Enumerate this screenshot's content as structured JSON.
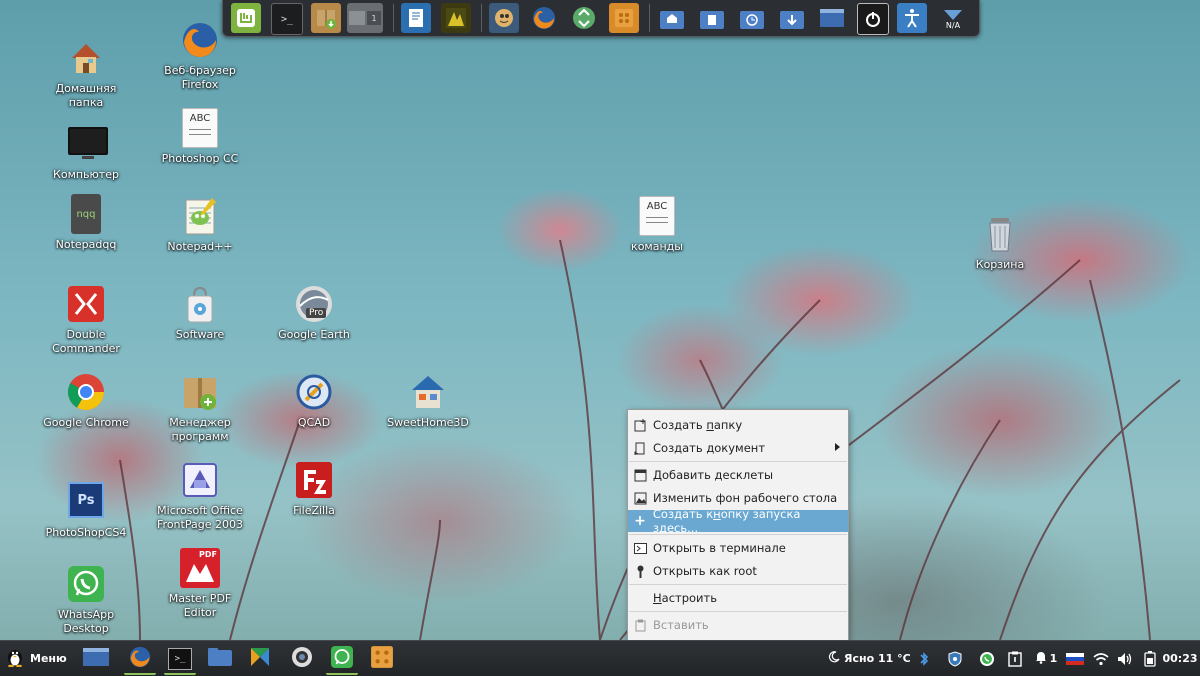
{
  "desktop": {
    "icons": [
      {
        "name": "home-folder",
        "label": "Домашняя папка"
      },
      {
        "name": "firefox",
        "label": "Веб-браузер Firefox"
      },
      {
        "name": "computer",
        "label": "Компьютер"
      },
      {
        "name": "photoshop-cc",
        "label": "Photoshop CC"
      },
      {
        "name": "notepadqq",
        "label": "Notepadqq"
      },
      {
        "name": "notepad-plus",
        "label": "Notepad++"
      },
      {
        "name": "double-commander",
        "label": "Double Commander"
      },
      {
        "name": "software",
        "label": "Software"
      },
      {
        "name": "google-earth",
        "label": "Google Earth"
      },
      {
        "name": "google-chrome",
        "label": "Google Chrome"
      },
      {
        "name": "package-manager",
        "label": "Менеджер программ"
      },
      {
        "name": "qcad",
        "label": "QCAD"
      },
      {
        "name": "sweethome3d",
        "label": "SweetHome3D"
      },
      {
        "name": "photoshop-cs4",
        "label": "PhotoShopCS4"
      },
      {
        "name": "frontpage",
        "label": "Microsoft Office FrontPage 2003"
      },
      {
        "name": "filezilla",
        "label": "FileZilla"
      },
      {
        "name": "whatsapp",
        "label": "WhatsApp Desktop"
      },
      {
        "name": "master-pdf",
        "label": "Master PDF Editor"
      },
      {
        "name": "commands-file",
        "label": "команды"
      },
      {
        "name": "trash",
        "label": "Корзина"
      }
    ],
    "file_icon_text": "ABC",
    "notepadqq_icon_text": "nqq",
    "photoshop_icon_text": "Ps",
    "google_earth_badge": "Pro",
    "master_pdf_badge": "PDF"
  },
  "dock": {
    "items": [
      "mint-menu",
      "terminal",
      "package-installer",
      "workspace-switcher",
      "text-editor",
      "image-viewer",
      "mail",
      "firefox",
      "recycle",
      "archive",
      "home-folder",
      "documents-folder",
      "recent-folder",
      "downloads-folder",
      "show-desktop",
      "shutdown",
      "accessibility",
      "network"
    ],
    "network_label": "N/A"
  },
  "context_menu": {
    "items": [
      {
        "pre": "Создать ",
        "u": "п",
        "post": "апку",
        "icon": "new-folder-icon",
        "state": "normal"
      },
      {
        "pre": "Создать ",
        "u": "д",
        "post": "окумент",
        "icon": "new-document-icon",
        "state": "normal",
        "submenu": true
      },
      {
        "pre": "",
        "u": "",
        "post": "Добавить десклеты",
        "icon": "desklet-icon",
        "state": "normal"
      },
      {
        "pre": "",
        "u": "",
        "post": "Изменить фон рабочего стола",
        "icon": "wallpaper-icon",
        "state": "normal"
      },
      {
        "pre": "Создать к",
        "u": "н",
        "post": "опку запуска здесь...",
        "icon": "plus-icon",
        "state": "active"
      },
      {
        "pre": "",
        "u": "",
        "post": "Открыть в терминале",
        "icon": "terminal-icon",
        "state": "normal"
      },
      {
        "pre": "",
        "u": "",
        "post": "Открыть как root",
        "icon": "key-icon",
        "state": "normal"
      },
      {
        "pre": "",
        "u": "Н",
        "post": "астроить",
        "icon": "",
        "state": "normal"
      },
      {
        "pre": "",
        "u": "",
        "post": "Вставить",
        "icon": "paste-icon",
        "state": "disabled"
      }
    ]
  },
  "panel": {
    "menu_label": "Меню",
    "weather": "Ясно 11 °C",
    "notifications_count": "1",
    "clock": "00:23"
  },
  "colors": {
    "menu_highlight": "#6aa8d2",
    "panel_bg": "#2b2e32",
    "running_indicator": "#8fc25b"
  }
}
